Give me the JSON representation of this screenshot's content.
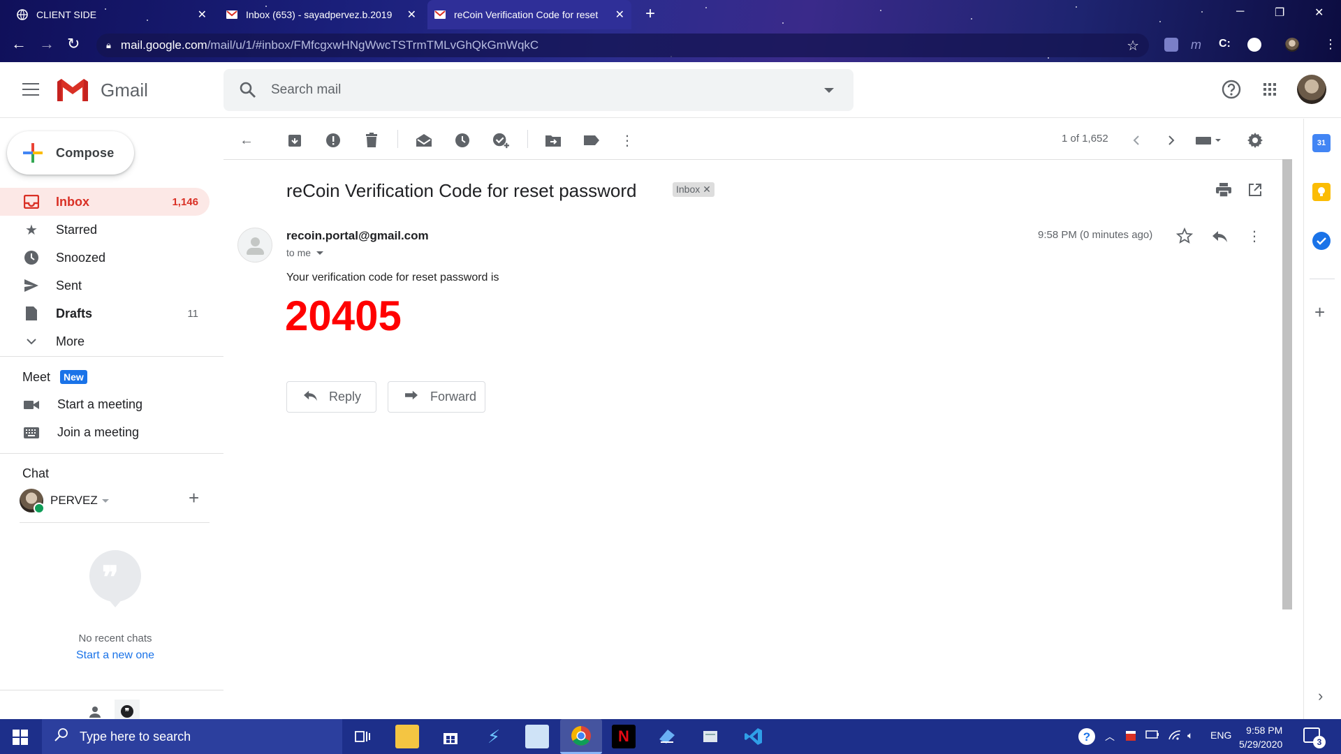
{
  "browser": {
    "tabs": [
      {
        "title": "CLIENT SIDE",
        "favicon": "globe-icon"
      },
      {
        "title": "Inbox (653) - sayadpervez.b.2019",
        "favicon": "gmail-icon"
      },
      {
        "title": "reCoin Verification Code for reset",
        "favicon": "gmail-icon",
        "active": true
      }
    ],
    "url_host": "mail.google.com",
    "url_path": "/mail/u/1/#inbox/FMfcgxwHNgWwcTSTrmTMLvGhQkGmWqkC"
  },
  "gmail": {
    "brand": "Gmail",
    "search_placeholder": "Search mail",
    "compose_label": "Compose",
    "nav": [
      {
        "label": "Inbox",
        "count": "1,146",
        "icon": "inbox-icon",
        "active": true
      },
      {
        "label": "Starred",
        "count": "",
        "icon": "star-icon"
      },
      {
        "label": "Snoozed",
        "count": "",
        "icon": "clock-icon"
      },
      {
        "label": "Sent",
        "count": "",
        "icon": "send-icon"
      },
      {
        "label": "Drafts",
        "count": "11",
        "icon": "draft-icon"
      },
      {
        "label": "More",
        "count": "",
        "icon": "chevron-down-icon"
      }
    ],
    "meet": {
      "title": "Meet",
      "badge": "New",
      "items": [
        "Start a meeting",
        "Join a meeting"
      ]
    },
    "chat": {
      "title": "Chat",
      "user": "PERVEZ",
      "empty_text": "No recent chats",
      "start_link": "Start a new one"
    },
    "pager": "1 of 1,652",
    "message": {
      "subject": "reCoin Verification Code for reset password",
      "label_chip": "Inbox",
      "sender": "recoin.portal@gmail.com",
      "recipient": "to me",
      "time": "9:58 PM (0 minutes ago)",
      "body": "Your verification code for reset password is",
      "code": "20405",
      "reply_label": "Reply",
      "forward_label": "Forward"
    }
  },
  "taskbar": {
    "search_placeholder": "Type here to search",
    "language": "ENG",
    "time": "9:58 PM",
    "date": "5/29/2020",
    "notifications": "3"
  },
  "colors": {
    "accent_red": "#d93025",
    "code_red": "#ff0000",
    "link_blue": "#1a73e8",
    "taskbar": "#1d2f8a"
  }
}
